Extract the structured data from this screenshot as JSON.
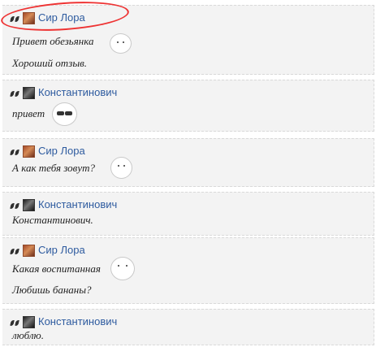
{
  "posts": [
    {
      "author": "Сир Лора",
      "avatar": "sir-lora-avatar",
      "lines": [
        "Привет обезьянка",
        "Хороший отзыв."
      ]
    },
    {
      "author": "Константинович",
      "avatar": "konstantinovich-avatar",
      "lines": [
        "привет"
      ]
    },
    {
      "author": "Сир Лора",
      "avatar": "sir-lora-avatar",
      "lines": [
        "А как тебя зовут?"
      ]
    },
    {
      "author": "Константинович",
      "avatar": "konstantinovich-avatar",
      "lines": [
        "Константинович."
      ]
    },
    {
      "author": "Сир Лора",
      "avatar": "sir-lora-avatar",
      "lines": [
        "Какая воспитанная",
        "Любишь бананы?"
      ]
    },
    {
      "author": "Константинович",
      "avatar": "konstantinovich-avatar",
      "lines": [
        "люблю."
      ]
    }
  ],
  "colors": {
    "author_link": "#2e5b9f",
    "post_background": "#f3f3f3",
    "highlight_circle": "#e33333"
  },
  "icons": {
    "quote": "quote-icon",
    "emoticon": "emoticon-icon",
    "sunglasses_emoticon": "sunglasses-emoticon-icon"
  }
}
